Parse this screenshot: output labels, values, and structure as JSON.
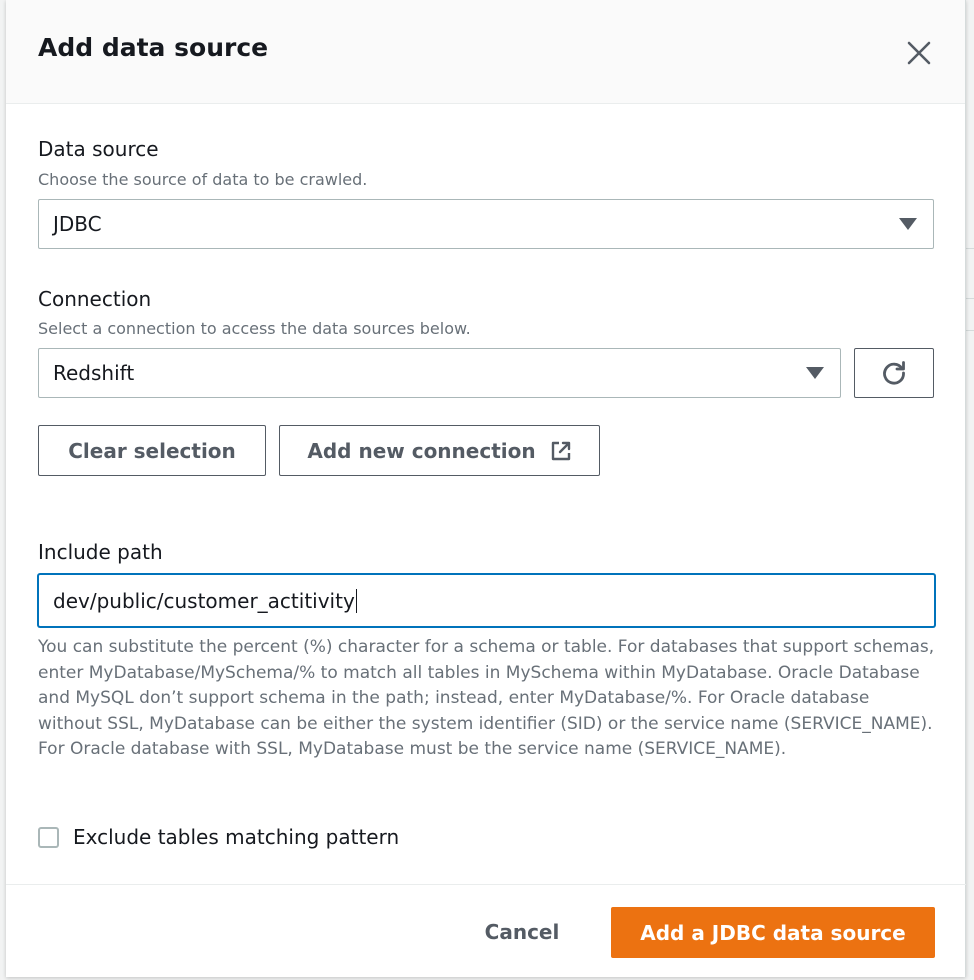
{
  "modal": {
    "title": "Add data source",
    "close_icon": "close-icon"
  },
  "data_source": {
    "label": "Data source",
    "description": "Choose the source of data to be crawled.",
    "selected": "JDBC"
  },
  "connection": {
    "label": "Connection",
    "description": "Select a connection to access the data sources below.",
    "selected": "Redshift",
    "refresh_icon": "refresh-icon"
  },
  "actions": {
    "clear_selection": "Clear selection",
    "add_new_connection": "Add new connection",
    "external_link_icon": "external-link-icon"
  },
  "include_path": {
    "label": "Include path",
    "value": "dev/public/customer_actitivity",
    "help": "You can substitute the percent (%) character for a schema or table. For databases that support schemas, enter MyDatabase/MySchema/% to match all tables in MySchema within MyDatabase. Oracle Database and MySQL don’t support schema in the path; instead, enter MyDatabase/%. For Oracle database without SSL, MyDatabase can be either the system identifier (SID) or the service name (SERVICE_NAME). For Oracle database with SSL, MyDatabase must be the service name (SERVICE_NAME)."
  },
  "exclude": {
    "label": "Exclude tables matching pattern",
    "checked": false
  },
  "footer": {
    "cancel": "Cancel",
    "submit": "Add a JDBC data source"
  },
  "colors": {
    "primary": "#ec7211",
    "focus": "#0073bb",
    "text": "#16191f",
    "secondary_text": "#687078"
  }
}
